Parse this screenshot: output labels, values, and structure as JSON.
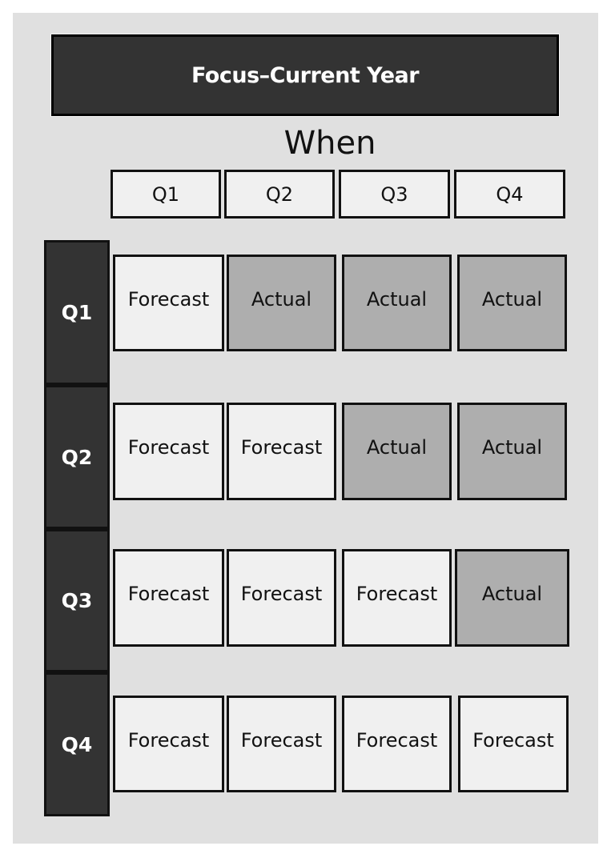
{
  "title": "Focus–Current Year",
  "axis_label": "When",
  "columns": [
    "Q1",
    "Q2",
    "Q3",
    "Q4"
  ],
  "rows": [
    {
      "label": "Q1",
      "cells": [
        "Forecast",
        "Actual",
        "Actual",
        "Actual"
      ]
    },
    {
      "label": "Q2",
      "cells": [
        "Forecast",
        "Forecast",
        "Actual",
        "Actual"
      ]
    },
    {
      "label": "Q3",
      "cells": [
        "Forecast",
        "Forecast",
        "Forecast",
        "Actual"
      ]
    },
    {
      "label": "Q4",
      "cells": [
        "Forecast",
        "Forecast",
        "Forecast",
        "Forecast"
      ]
    }
  ],
  "colors": {
    "panel": "#e0e0e0",
    "header_dark": "#333333",
    "forecast_fill": "#f0f0f0",
    "actual_fill": "#aeaeae"
  }
}
